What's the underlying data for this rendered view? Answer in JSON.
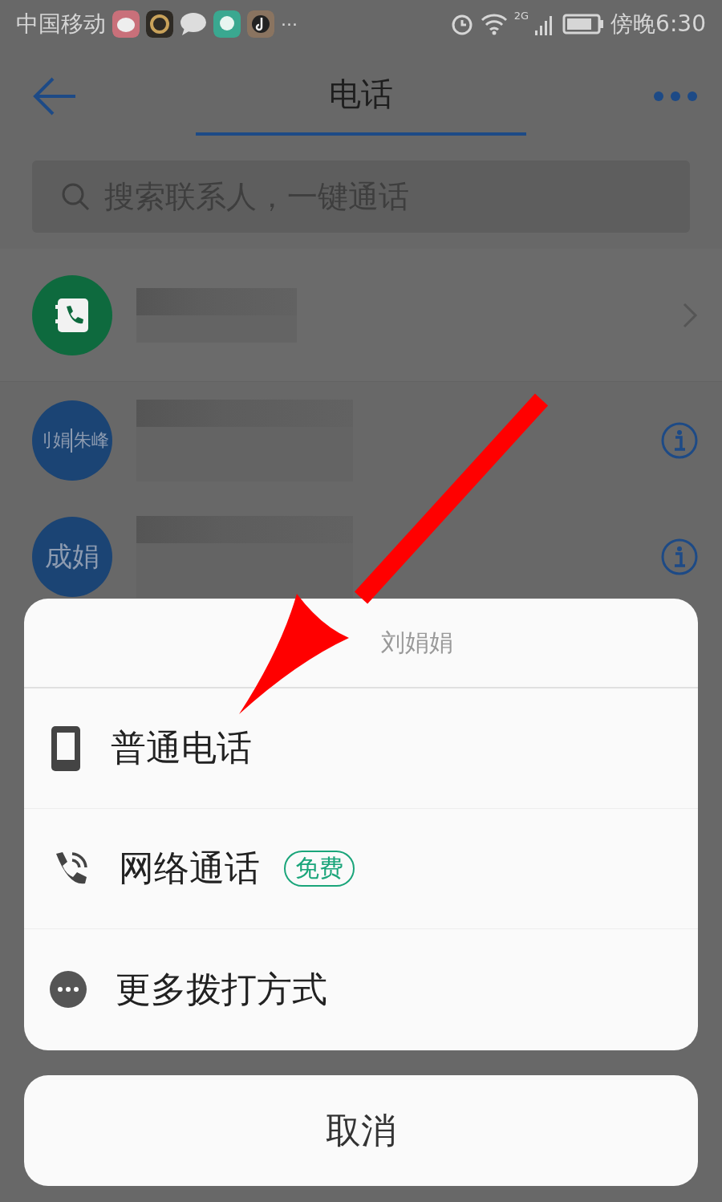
{
  "status_bar": {
    "carrier": "中国移动",
    "more": "···",
    "network": "2G",
    "time": "傍晚6:30"
  },
  "app_bar": {
    "title": "电话"
  },
  "search": {
    "placeholder": "搜索联系人，一键通话"
  },
  "contacts": [
    {
      "kind": "service"
    },
    {
      "kind": "person",
      "avatar_texts": [
        "刂娟",
        "朱峰"
      ]
    },
    {
      "kind": "person",
      "avatar_texts": [
        "成娟"
      ]
    }
  ],
  "action_sheet": {
    "header": "刘娟娟",
    "options": [
      {
        "kind": "phone",
        "label": "普通电话"
      },
      {
        "kind": "voip",
        "label": "网络通话",
        "badge": "免费"
      },
      {
        "kind": "more",
        "label": "更多拨打方式"
      }
    ],
    "cancel": "取消"
  }
}
